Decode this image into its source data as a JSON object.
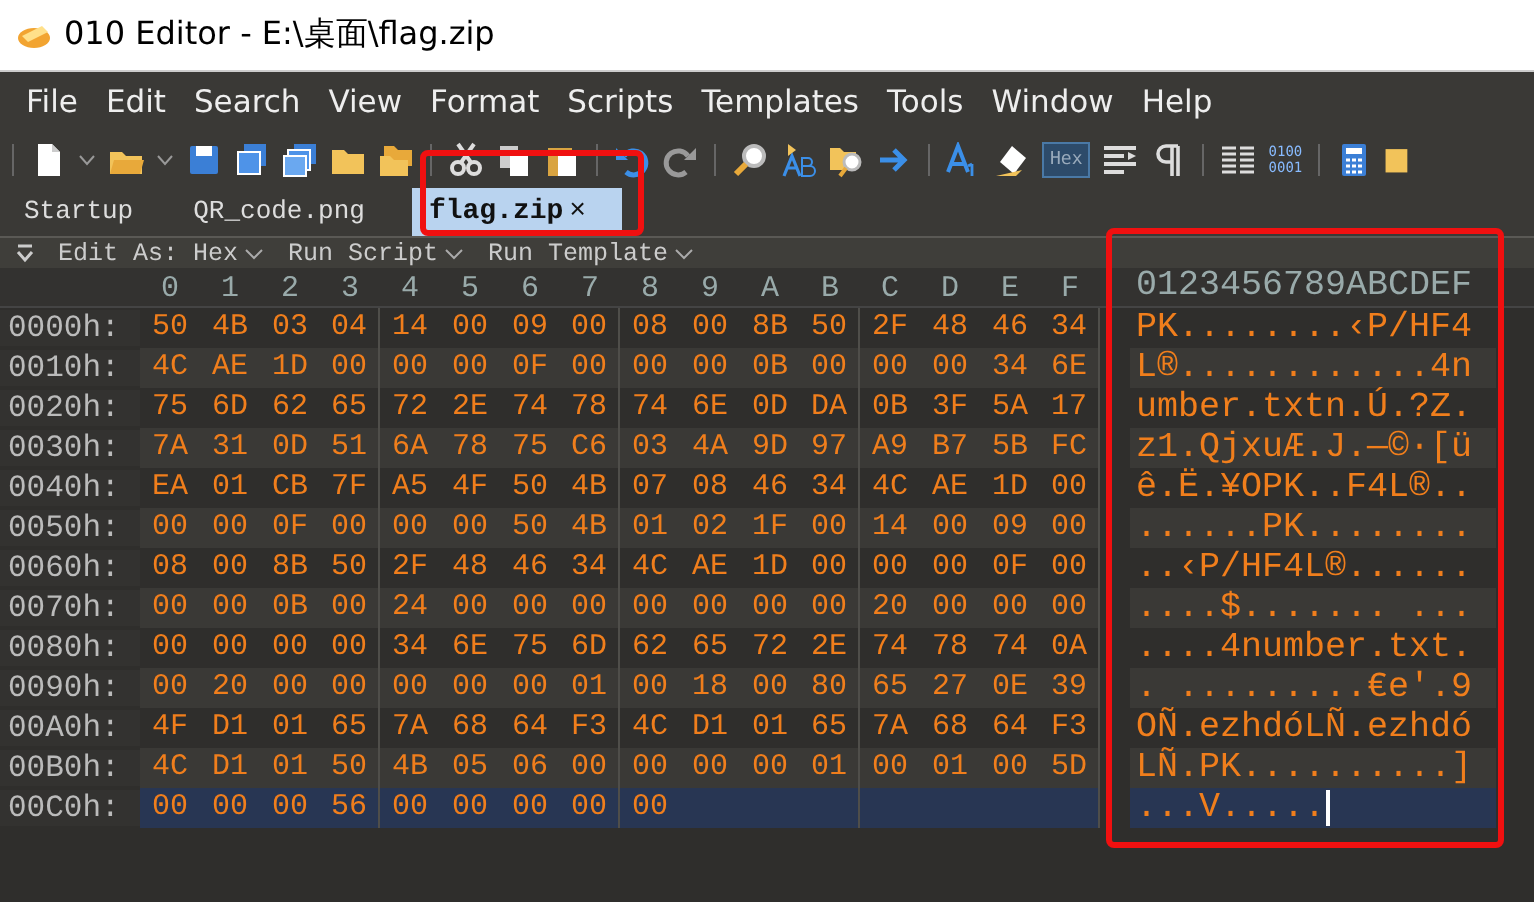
{
  "window": {
    "title": "010 Editor - E:\\桌面\\flag.zip"
  },
  "menu": [
    "File",
    "Edit",
    "Search",
    "View",
    "Format",
    "Scripts",
    "Templates",
    "Tools",
    "Window",
    "Help"
  ],
  "toolbar": {
    "hex_toggle": {
      "label": "Hex",
      "selected": true
    },
    "binary_label": [
      "0100",
      "0001"
    ]
  },
  "tabs": [
    {
      "label": "Startup",
      "selected": false
    },
    {
      "label": "QR_code.png",
      "selected": false
    },
    {
      "label": "flag.zip",
      "selected": true,
      "close": "×"
    }
  ],
  "edit_bar": [
    "Edit As: Hex",
    "Run Script",
    "Run Template"
  ],
  "hex_header": [
    "0",
    "1",
    "2",
    "3",
    "4",
    "5",
    "6",
    "7",
    "8",
    "9",
    "A",
    "B",
    "C",
    "D",
    "E",
    "F"
  ],
  "text_header": "0123456789ABCDEF",
  "rows": [
    {
      "offset": "0000h:",
      "bytes": [
        "50",
        "4B",
        "03",
        "04",
        "14",
        "00",
        "09",
        "00",
        "08",
        "00",
        "8B",
        "50",
        "2F",
        "48",
        "46",
        "34"
      ],
      "text": "PK........‹P/HF4",
      "selected": false
    },
    {
      "offset": "0010h:",
      "bytes": [
        "4C",
        "AE",
        "1D",
        "00",
        "00",
        "00",
        "0F",
        "00",
        "00",
        "00",
        "0B",
        "00",
        "00",
        "00",
        "34",
        "6E"
      ],
      "text": "L®............4n",
      "selected": false
    },
    {
      "offset": "0020h:",
      "bytes": [
        "75",
        "6D",
        "62",
        "65",
        "72",
        "2E",
        "74",
        "78",
        "74",
        "6E",
        "0D",
        "DA",
        "0B",
        "3F",
        "5A",
        "17"
      ],
      "text": "umber.txtn.Ú.?Z.",
      "selected": false
    },
    {
      "offset": "0030h:",
      "bytes": [
        "7A",
        "31",
        "0D",
        "51",
        "6A",
        "78",
        "75",
        "C6",
        "03",
        "4A",
        "9D",
        "97",
        "A9",
        "B7",
        "5B",
        "FC"
      ],
      "text": "z1.QjxuÆ.J.—©·[ü",
      "selected": false
    },
    {
      "offset": "0040h:",
      "bytes": [
        "EA",
        "01",
        "CB",
        "7F",
        "A5",
        "4F",
        "50",
        "4B",
        "07",
        "08",
        "46",
        "34",
        "4C",
        "AE",
        "1D",
        "00"
      ],
      "text": "ê.Ë.¥OPK..F4L®..",
      "selected": false
    },
    {
      "offset": "0050h:",
      "bytes": [
        "00",
        "00",
        "0F",
        "00",
        "00",
        "00",
        "50",
        "4B",
        "01",
        "02",
        "1F",
        "00",
        "14",
        "00",
        "09",
        "00"
      ],
      "text": "......PK........",
      "selected": false
    },
    {
      "offset": "0060h:",
      "bytes": [
        "08",
        "00",
        "8B",
        "50",
        "2F",
        "48",
        "46",
        "34",
        "4C",
        "AE",
        "1D",
        "00",
        "00",
        "00",
        "0F",
        "00"
      ],
      "text": "..‹P/HF4L®......",
      "selected": false
    },
    {
      "offset": "0070h:",
      "bytes": [
        "00",
        "00",
        "0B",
        "00",
        "24",
        "00",
        "00",
        "00",
        "00",
        "00",
        "00",
        "00",
        "20",
        "00",
        "00",
        "00"
      ],
      "text": "....$....... ...",
      "selected": false
    },
    {
      "offset": "0080h:",
      "bytes": [
        "00",
        "00",
        "00",
        "00",
        "34",
        "6E",
        "75",
        "6D",
        "62",
        "65",
        "72",
        "2E",
        "74",
        "78",
        "74",
        "0A"
      ],
      "text": "....4number.txt.",
      "selected": false
    },
    {
      "offset": "0090h:",
      "bytes": [
        "00",
        "20",
        "00",
        "00",
        "00",
        "00",
        "00",
        "01",
        "00",
        "18",
        "00",
        "80",
        "65",
        "27",
        "0E",
        "39"
      ],
      "text": ". .........€e'.9",
      "selected": false
    },
    {
      "offset": "00A0h:",
      "bytes": [
        "4F",
        "D1",
        "01",
        "65",
        "7A",
        "68",
        "64",
        "F3",
        "4C",
        "D1",
        "01",
        "65",
        "7A",
        "68",
        "64",
        "F3"
      ],
      "text": "OÑ.ezhdóLÑ.ezhdó",
      "selected": false
    },
    {
      "offset": "00B0h:",
      "bytes": [
        "4C",
        "D1",
        "01",
        "50",
        "4B",
        "05",
        "06",
        "00",
        "00",
        "00",
        "00",
        "01",
        "00",
        "01",
        "00",
        "5D"
      ],
      "text": "LÑ.PK..........]",
      "selected": false
    },
    {
      "offset": "00C0h:",
      "bytes": [
        "00",
        "00",
        "00",
        "56",
        "00",
        "00",
        "00",
        "00",
        "00"
      ],
      "text": "...V.....",
      "selected": true
    }
  ]
}
